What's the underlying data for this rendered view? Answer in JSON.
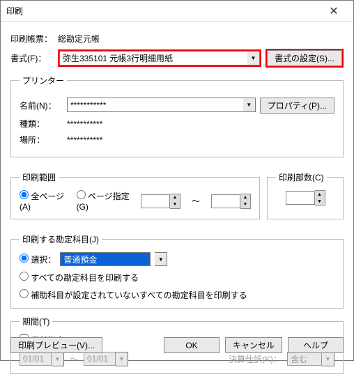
{
  "window": {
    "title": "印刷"
  },
  "header": {
    "form_label": "印刷帳票：",
    "form_value": "総勘定元帳",
    "format_label": "書式(F)：",
    "format_value": "弥生335101 元帳3行明細用紙",
    "format_settings_btn": "書式の設定(S)..."
  },
  "printer": {
    "legend": "プリンター",
    "name_label": "名前(N)：",
    "name_value": "***********",
    "properties_btn": "プロパティ(P)...",
    "type_label": "種類：",
    "type_value": "***********",
    "location_label": "場所：",
    "location_value": "***********"
  },
  "range": {
    "legend": "印刷範囲",
    "all_label": "全ページ(A)",
    "page_label": "ページ指定(G)",
    "tilde": "～"
  },
  "copies": {
    "legend": "印刷部数(C)"
  },
  "accounts": {
    "legend": "印刷する勘定科目(J)",
    "select_label": "選択：",
    "select_value": "普通預金",
    "all_accounts_label": "すべての勘定科目を印刷する",
    "no_aux_label": "補助科目が設定されていないすべての勘定科目を印刷する"
  },
  "period": {
    "legend": "期間(T)",
    "date_spec_label": "日付指定",
    "from": "01/01",
    "to": "01/01",
    "closing_label": "決算仕訳(K)：",
    "closing_value": "含む",
    "tilde": "～"
  },
  "footer": {
    "preview_btn": "印刷プレビュー(V)...",
    "ok": "OK",
    "cancel": "キャンセル",
    "help": "ヘルプ"
  }
}
